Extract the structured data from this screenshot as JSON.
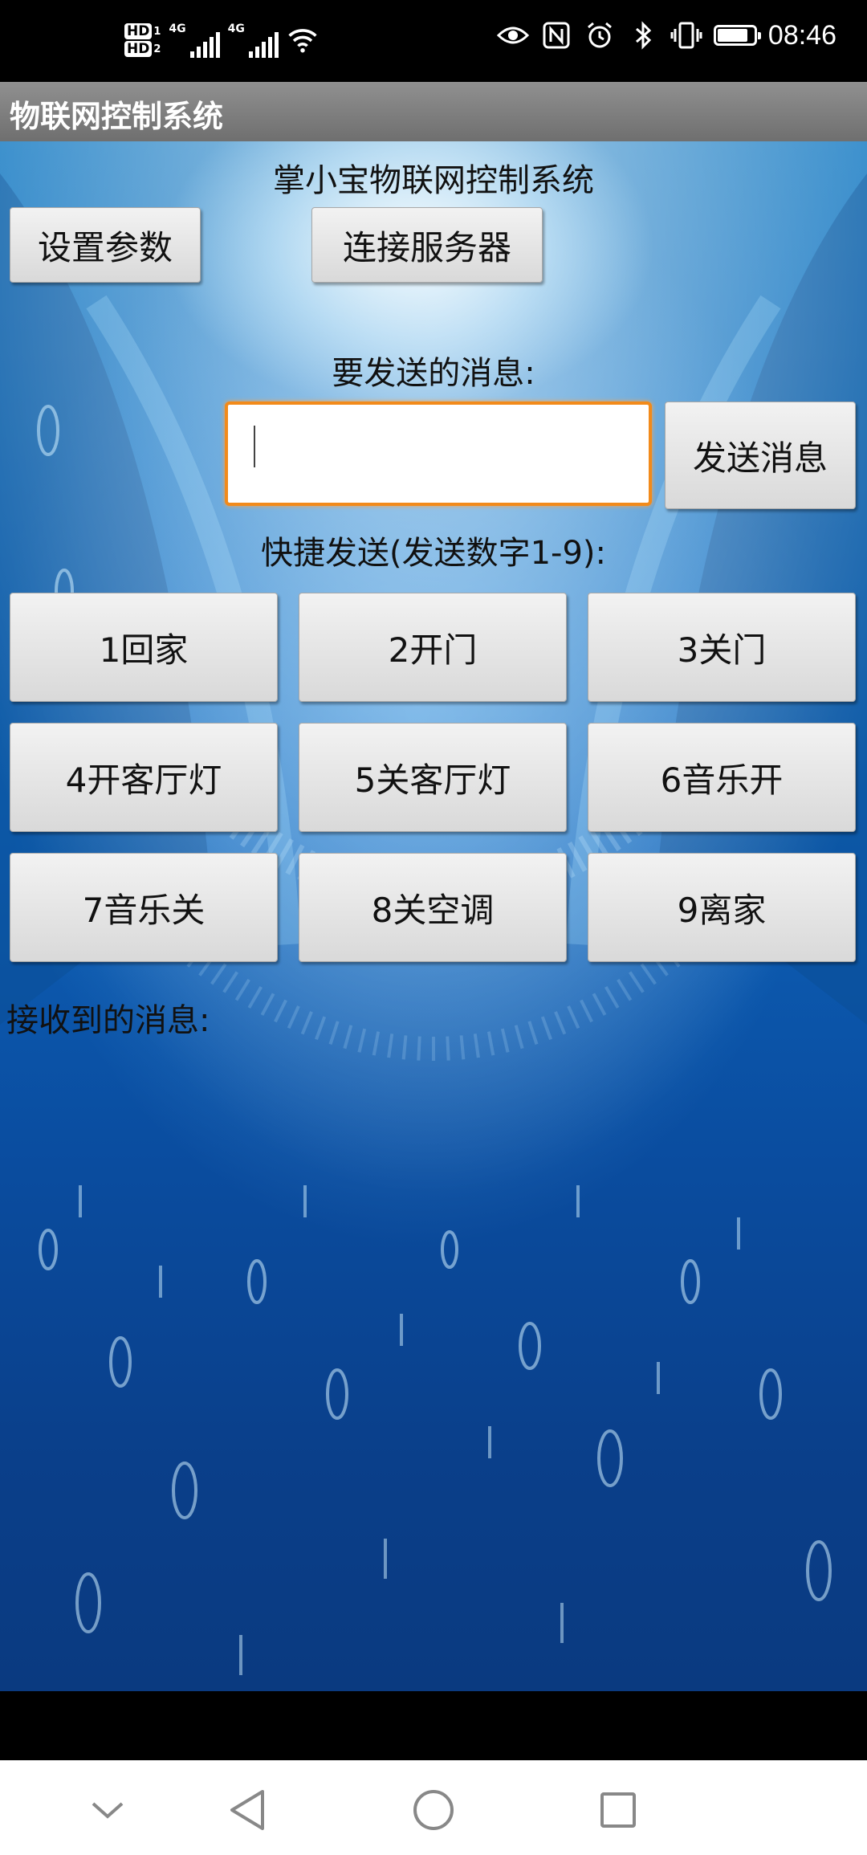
{
  "status_bar": {
    "sim1": {
      "badge": "HD",
      "slot": "1",
      "network": "4G"
    },
    "sim2": {
      "badge": "HD",
      "slot": "2",
      "network": "4G"
    },
    "time": "08:46",
    "battery_level": 0.85,
    "icons": [
      "eye-icon",
      "nfc-icon",
      "alarm-icon",
      "bluetooth-icon",
      "vibrate-icon",
      "battery-icon"
    ]
  },
  "app_bar": {
    "title": "物联网控制系统"
  },
  "main": {
    "heading": "掌小宝物联网控制系统",
    "settings_button": "设置参数",
    "connect_button": "连接服务器",
    "message_label": "要发送的消息:",
    "message_input": {
      "value": "",
      "placeholder": ""
    },
    "send_button": "发送消息",
    "quick_send_label": "快捷发送(发送数字1-9):",
    "quick_buttons": [
      {
        "label": "1回家"
      },
      {
        "label": "2开门"
      },
      {
        "label": "3关门"
      },
      {
        "label": "4开客厅灯"
      },
      {
        "label": "5关客厅灯"
      },
      {
        "label": "6音乐开"
      },
      {
        "label": "7音乐关"
      },
      {
        "label": "8关空调"
      },
      {
        "label": "9离家"
      }
    ],
    "received_label": "接收到的消息:",
    "received_text": ""
  },
  "nav_bar": {
    "icons": [
      "collapse-icon",
      "back-icon",
      "home-icon",
      "recents-icon"
    ]
  },
  "colors": {
    "input_focus": "#f28a1a",
    "app_bar": "#7f7f7f",
    "background": "#0d5fb5"
  }
}
